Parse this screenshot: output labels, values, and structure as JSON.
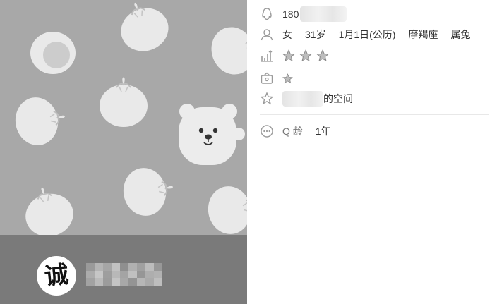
{
  "profile": {
    "avatar_char": "诚",
    "qq_number_visible": "180",
    "gender": "女",
    "age": "31岁",
    "birthday": "1月1日(公历)",
    "zodiac": "摩羯座",
    "chinese_zodiac": "属兔",
    "level_stars": 3,
    "vip_stars": 1,
    "space_suffix": "的空间",
    "qage_label": "Q 龄",
    "qage_value": "1年"
  },
  "icons": {
    "qq": "penguin-icon",
    "person": "person-icon",
    "level": "level-chart-icon",
    "vip": "crown-box-icon",
    "space": "star-outline-icon",
    "more": "more-dots-icon"
  },
  "colors": {
    "cover_bg": "#a8a8a8",
    "footer_bg": "#7a7a7a",
    "text": "#333333",
    "icon": "#9a9a9a"
  }
}
